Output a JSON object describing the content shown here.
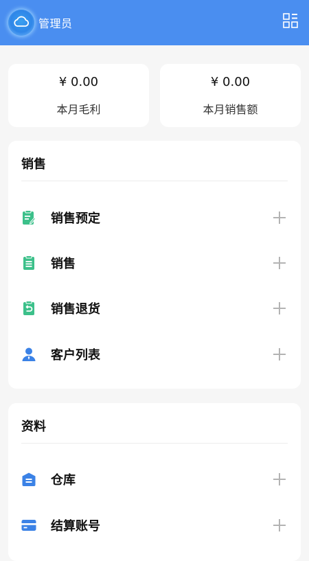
{
  "header": {
    "title": "管理员",
    "avatar_icon": "cloud-icon",
    "menu_icon": "grid-icon",
    "background_color": "#4a8ef0"
  },
  "stats": [
    {
      "value": "¥ 0.00",
      "label": "本月毛利"
    },
    {
      "value": "¥ 0.00",
      "label": "本月销售额"
    }
  ],
  "sales_section": {
    "title": "销售",
    "items": [
      {
        "label": "销售预定",
        "icon": "clipboard-edit-icon",
        "icon_color": "#3cc08a"
      },
      {
        "label": "销售",
        "icon": "clipboard-list-icon",
        "icon_color": "#3cc08a"
      },
      {
        "label": "销售退货",
        "icon": "clipboard-return-icon",
        "icon_color": "#3cc08a"
      },
      {
        "label": "客户列表",
        "icon": "user-icon",
        "icon_color": "#3b82e6"
      }
    ]
  },
  "data_section": {
    "title": "资料",
    "items": [
      {
        "label": "仓库",
        "icon": "warehouse-icon",
        "icon_color": "#3b82e6"
      },
      {
        "label": "结算账号",
        "icon": "card-icon",
        "icon_color": "#3b82e6"
      }
    ]
  }
}
